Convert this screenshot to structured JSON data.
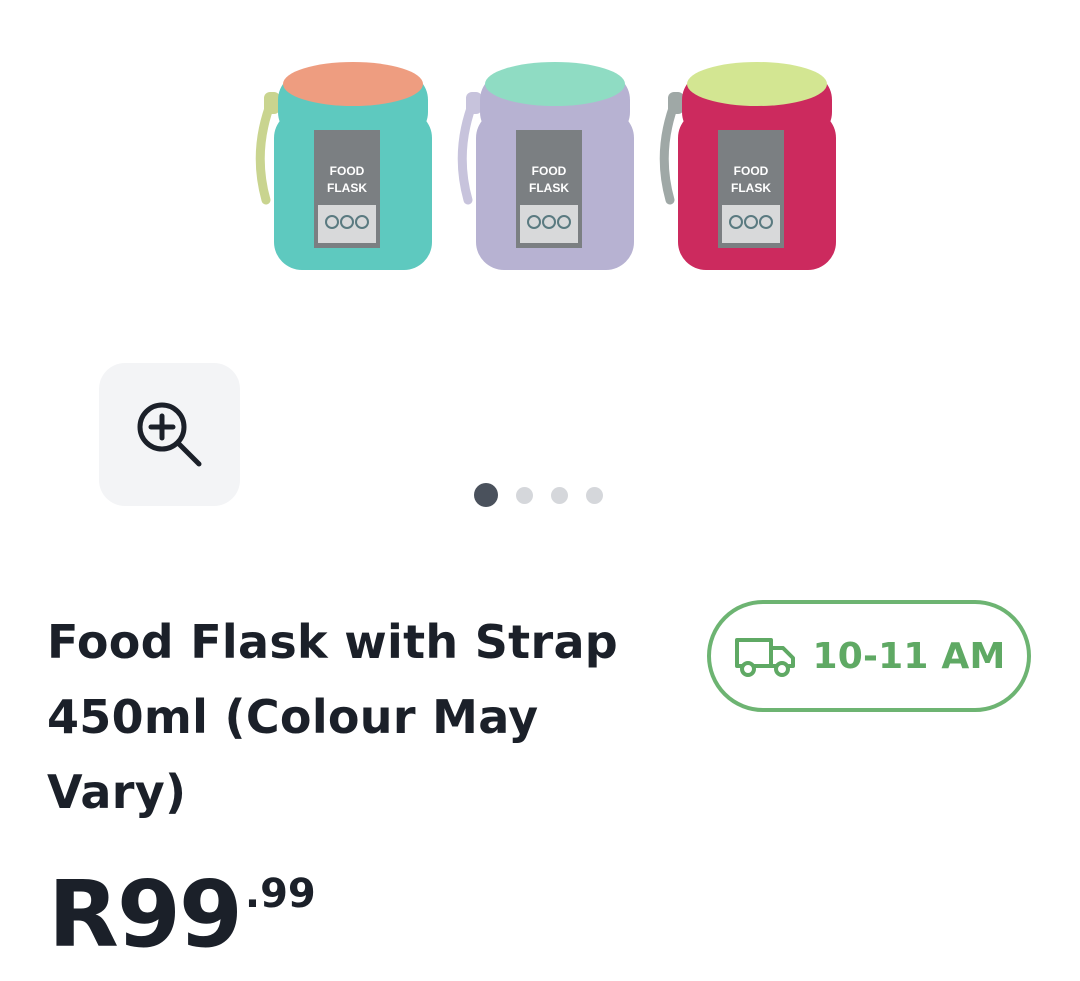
{
  "product": {
    "title": "Food Flask with Strap 450ml (Colour May Vary)",
    "price_main": "R99",
    "price_cents": ".99",
    "image": {
      "flasks": [
        {
          "body": "#5ec9bf",
          "lid": "#ee9d80",
          "strap": "#c9d48f",
          "label": [
            "FOOD",
            "FLASK"
          ]
        },
        {
          "body": "#b7b2d2",
          "lid": "#8fdcc3",
          "strap": "#c7c3dc",
          "label": [
            "FOOD",
            "FLASK"
          ]
        },
        {
          "body": "#cc2a5e",
          "lid": "#d3e692",
          "strap": "#9fa8a6",
          "label": [
            "FOOD",
            "FLASK"
          ]
        }
      ]
    }
  },
  "gallery": {
    "zoom_icon": "zoom-in-icon",
    "dots": [
      {
        "active": true
      },
      {
        "active": false
      },
      {
        "active": false
      },
      {
        "active": false
      }
    ]
  },
  "delivery": {
    "icon": "delivery-truck-icon",
    "window": "10-11 AM",
    "color": "#6db472"
  }
}
